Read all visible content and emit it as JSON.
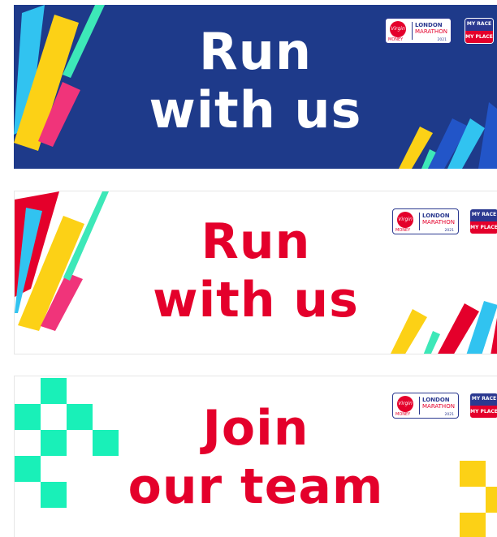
{
  "banners": [
    {
      "theme": "blue",
      "headline_line1": "Run",
      "headline_line2": "with us",
      "background_color": "#1e3a8a",
      "text_color": "#ffffff"
    },
    {
      "theme": "white",
      "headline_line1": "Run",
      "headline_line2": "with us",
      "background_color": "#ffffff",
      "text_color": "#e4002b"
    },
    {
      "theme": "white",
      "headline_line1": "Join",
      "headline_line2": "our team",
      "background_color": "#ffffff",
      "text_color": "#e4002b"
    }
  ],
  "logos": {
    "london_marathon": {
      "line1": "LONDON",
      "line2": "MARATHON",
      "year": "2021",
      "sponsor": "Virgin",
      "sponsor_sub": "MONEY"
    },
    "my_race_my_place": {
      "line1": "MY RACE",
      "line2": "MY PLACE"
    }
  },
  "colors": {
    "brand_red": "#e4002b",
    "brand_blue": "#2b3990",
    "yellow": "#fcd116",
    "cyan": "#31c3f0",
    "pink": "#f0347a",
    "mint": "#3de8b8",
    "teal_block": "#19f0b8"
  }
}
